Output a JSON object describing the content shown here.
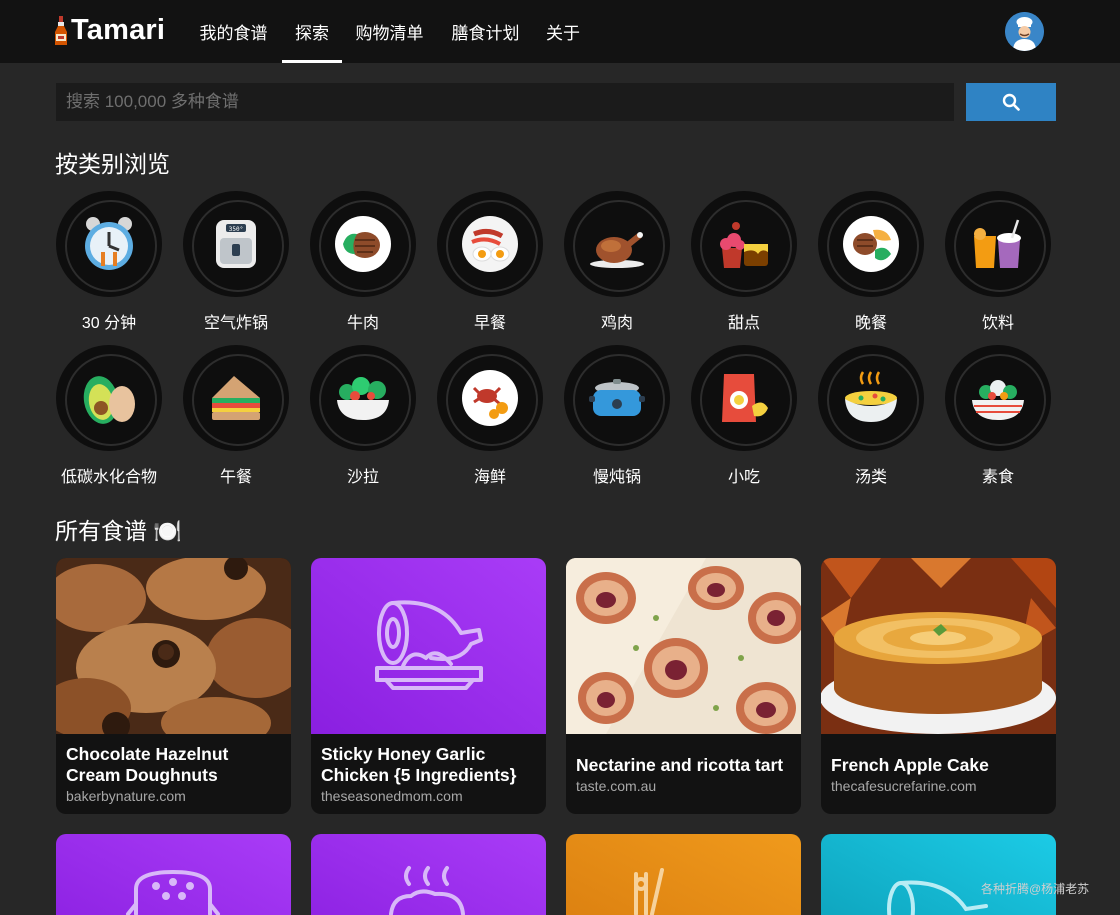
{
  "app": {
    "name": "Tamari"
  },
  "nav": {
    "items": [
      {
        "label": "我的食谱"
      },
      {
        "label": "探索"
      },
      {
        "label": "购物清单"
      },
      {
        "label": "膳食计划"
      },
      {
        "label": "关于"
      }
    ],
    "active_index": 1
  },
  "search": {
    "placeholder": "搜索 100,000 多种食谱",
    "value": "",
    "button_icon": "search-icon"
  },
  "categories": {
    "title": "按类别浏览",
    "items": [
      {
        "label": "30 分钟",
        "icon": "alarm-clock-icon"
      },
      {
        "label": "空气炸锅",
        "icon": "air-fryer-icon"
      },
      {
        "label": "牛肉",
        "icon": "steak-icon"
      },
      {
        "label": "早餐",
        "icon": "breakfast-plate-icon"
      },
      {
        "label": "鸡肉",
        "icon": "roast-chicken-icon"
      },
      {
        "label": "甜点",
        "icon": "dessert-icon"
      },
      {
        "label": "晚餐",
        "icon": "dinner-plate-icon"
      },
      {
        "label": "饮料",
        "icon": "drinks-icon"
      },
      {
        "label": "低碳水化合物",
        "icon": "avocado-egg-icon"
      },
      {
        "label": "午餐",
        "icon": "sandwich-icon"
      },
      {
        "label": "沙拉",
        "icon": "salad-bowl-icon"
      },
      {
        "label": "海鲜",
        "icon": "crab-icon"
      },
      {
        "label": "慢炖锅",
        "icon": "slow-cooker-icon"
      },
      {
        "label": "小吃",
        "icon": "snack-bag-icon"
      },
      {
        "label": "汤类",
        "icon": "soup-bowl-icon"
      },
      {
        "label": "素食",
        "icon": "vegetable-bowl-icon"
      }
    ]
  },
  "recipes": {
    "title": "所有食谱 🍽️",
    "cards": [
      {
        "title": "Chocolate Hazelnut Cream Doughnuts",
        "source": "bakerbynature.com",
        "image": "doughnuts-photo"
      },
      {
        "title": "Sticky Honey Garlic Chicken {5 Ingredients}",
        "source": "theseasonedmom.com",
        "image": "ham-placeholder-icon"
      },
      {
        "title": "Nectarine and ricotta tart",
        "source": "taste.com.au",
        "image": "tart-photo"
      },
      {
        "title": "French Apple Cake",
        "source": "thecafesucrefarine.com",
        "image": "apple-cake-photo"
      }
    ],
    "partial_cards": [
      {
        "image": "bread-placeholder-icon"
      },
      {
        "image": "steaming-dish-placeholder-icon"
      },
      {
        "image": "drink-placeholder-icon"
      },
      {
        "image": "ham-placeholder-icon"
      }
    ]
  },
  "watermark": "各种折腾@杨浦老苏",
  "colors": {
    "accent": "#2f83c4",
    "nav_bg": "#121212",
    "page_bg": "#272727",
    "purple_card": "#9b2ff0",
    "orange_card": "#e08a12",
    "teal_card": "#13b6d3"
  }
}
